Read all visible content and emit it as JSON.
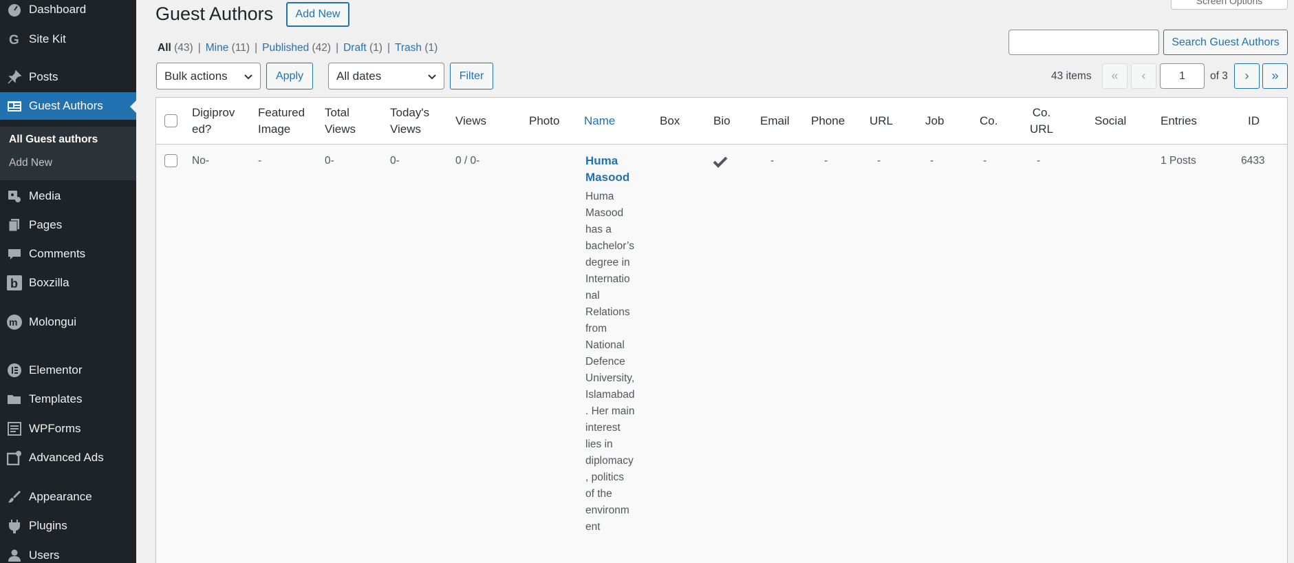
{
  "sidebar": {
    "items": [
      {
        "label": "Dashboard",
        "icon": "dashboard-icon"
      },
      {
        "label": "Site Kit",
        "icon": "sitekit-icon"
      },
      {
        "label": "Posts",
        "icon": "pin-icon"
      },
      {
        "label": "Guest Authors",
        "icon": "id-card-icon"
      },
      {
        "label": "Media",
        "icon": "media-icon"
      },
      {
        "label": "Pages",
        "icon": "pages-icon"
      },
      {
        "label": "Comments",
        "icon": "comment-icon"
      },
      {
        "label": "Boxzilla",
        "icon": "boxzilla-icon"
      },
      {
        "label": "Molongui",
        "icon": "molongui-icon"
      },
      {
        "label": "Elementor",
        "icon": "elementor-icon"
      },
      {
        "label": "Templates",
        "icon": "folder-icon"
      },
      {
        "label": "WPForms",
        "icon": "wpforms-icon"
      },
      {
        "label": "Advanced Ads",
        "icon": "ads-icon"
      },
      {
        "label": "Appearance",
        "icon": "brush-icon"
      },
      {
        "label": "Plugins",
        "icon": "plugin-icon"
      },
      {
        "label": "Users",
        "icon": "users-icon"
      }
    ],
    "submenu": [
      "All Guest authors",
      "Add New"
    ]
  },
  "header": {
    "title": "Guest Authors",
    "add_new": "Add New",
    "screen_options": "Screen Options"
  },
  "views": [
    {
      "label": "All",
      "count": "(43)"
    },
    {
      "label": "Mine",
      "count": "(11)"
    },
    {
      "label": "Published",
      "count": "(42)"
    },
    {
      "label": "Draft",
      "count": "(1)"
    },
    {
      "label": "Trash",
      "count": "(1)"
    }
  ],
  "search": {
    "value": "",
    "button": "Search Guest Authors"
  },
  "toolbar": {
    "bulk_actions": "Bulk actions",
    "apply": "Apply",
    "all_dates": "All dates",
    "filter": "Filter"
  },
  "pagination": {
    "items": "43 items",
    "first": "«",
    "prev": "‹",
    "current": "1",
    "of": "of 3",
    "next": "›",
    "last": "»"
  },
  "table": {
    "columns": {
      "digiproved": "Digiprov ed?",
      "featured_image": "Featured Image",
      "total_views": "Total Views",
      "todays_views": "Today's Views",
      "views": "Views",
      "photo": "Photo",
      "name": "Name",
      "box": "Box",
      "bio": "Bio",
      "email": "Email",
      "phone": "Phone",
      "url": "URL",
      "job": "Job",
      "co": "Co.",
      "co_url": "Co. URL",
      "social": "Social",
      "entries": "Entries",
      "id": "ID"
    },
    "rows": [
      {
        "digiproved": "No-",
        "featured_image": "-",
        "total_views": "0-",
        "todays_views": "0-",
        "views": "0 / 0-",
        "name": "Huma Masood",
        "bio": "Huma Masood has a bachelor’s degree in International Relations from National Defence University, Islamabad. Her main interest lies in diplomacy, politics of the environment",
        "email": "-",
        "phone": "-",
        "url": "-",
        "job": "-",
        "co": "-",
        "co_url": "-",
        "entries": "1 Posts",
        "id": "6433"
      }
    ]
  }
}
